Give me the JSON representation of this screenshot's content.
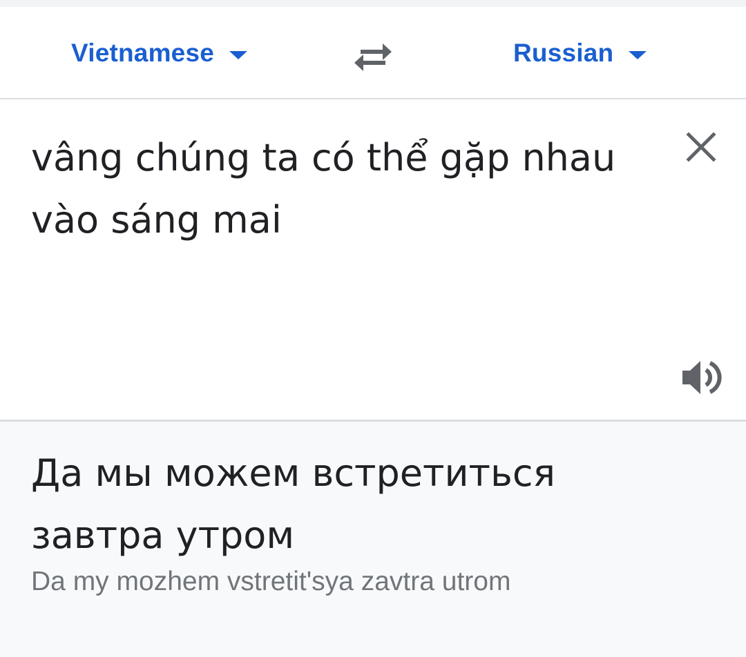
{
  "language_bar": {
    "source_language": "Vietnamese",
    "target_language": "Russian",
    "icons": {
      "source_dropdown": "chevron-down-icon",
      "swap": "swap-icon",
      "target_dropdown": "chevron-down-icon"
    },
    "accent_color": "#1a5fd0"
  },
  "input": {
    "text": "vâng chúng ta có thể gặp nhau vào sáng mai",
    "clear_icon": "close-icon",
    "speak_icon": "speaker-icon"
  },
  "output": {
    "translation": "Да мы можем встретиться завтра утром",
    "romanization": "Da my mozhem vstretit'sya zavtra utrom"
  }
}
